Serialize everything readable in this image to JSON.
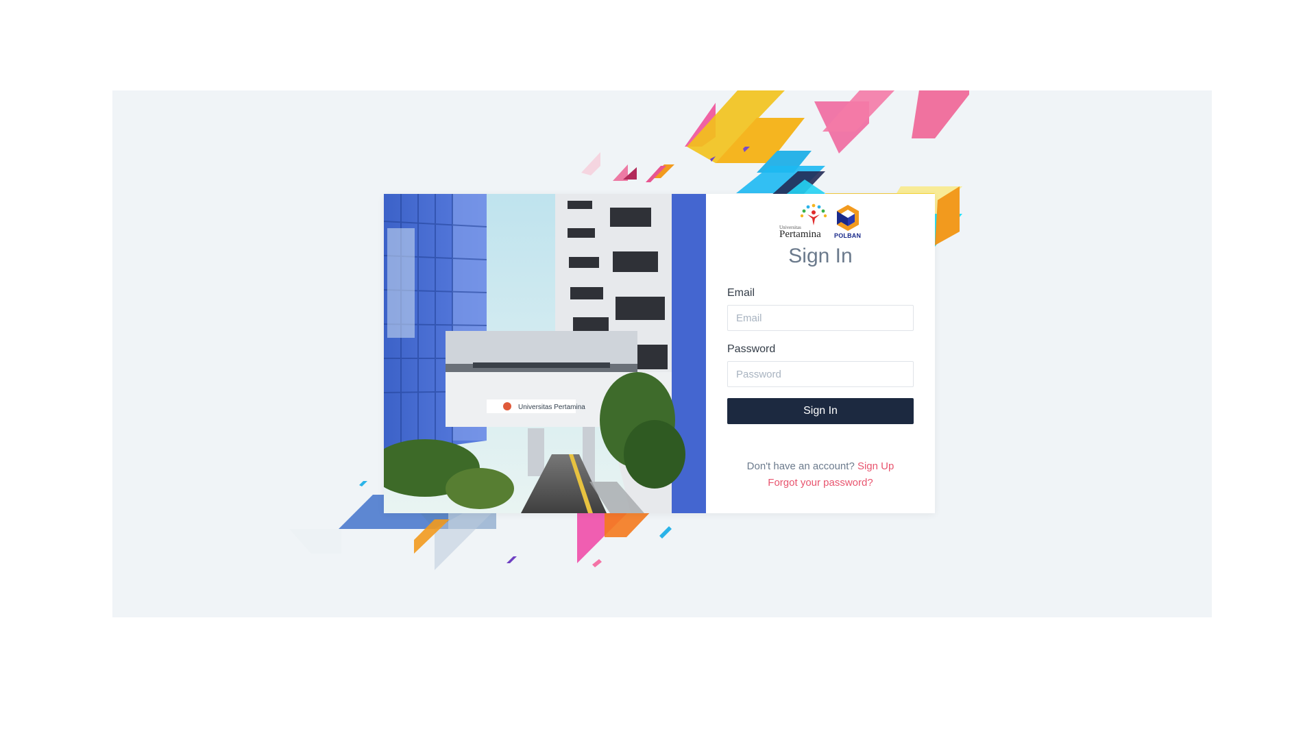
{
  "logo": {
    "university_small": "Universitas",
    "university_name": "Pertamina",
    "partner_name": "POLBAN"
  },
  "photo": {
    "building_sign": "Universitas Pertamina"
  },
  "form": {
    "title": "Sign In",
    "email_label": "Email",
    "email_placeholder": "Email",
    "password_label": "Password",
    "password_placeholder": "Password",
    "submit_label": "Sign In",
    "no_account_text": "Don't have an account?",
    "signup_link": "Sign Up",
    "forgot_link": "Forgot your password?"
  },
  "colors": {
    "background": "#f0f4f7",
    "button": "#1c2940",
    "link": "#e8546e",
    "title": "#6b7a8c"
  }
}
